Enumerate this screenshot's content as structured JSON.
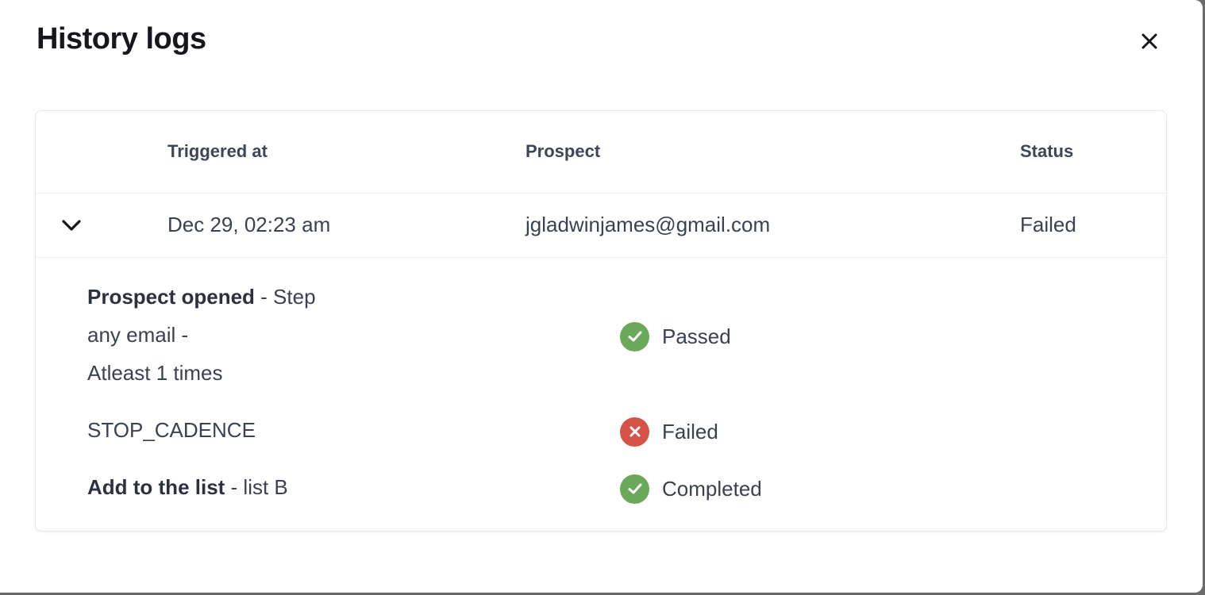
{
  "modal": {
    "title": "History logs",
    "close_icon": "close-icon"
  },
  "table": {
    "columns": {
      "triggered_at": "Triggered at",
      "prospect": "Prospect",
      "status": "Status"
    },
    "rows": [
      {
        "triggered_at": "Dec 29, 02:23 am",
        "prospect": "jgladwinjames@gmail.com",
        "status": "Failed",
        "expanded": true,
        "toggle_icon": "chevron-down-icon",
        "details": [
          {
            "bold": "Prospect opened",
            "rest_line1": " - Step",
            "line2": "any email -",
            "line3": "Atleast 1 times",
            "status": "Passed",
            "status_icon": "check-circle-icon",
            "status_color": "#6aa85a"
          },
          {
            "text": "STOP_CADENCE",
            "status": "Failed",
            "status_icon": "x-circle-icon",
            "status_color": "#d35446"
          },
          {
            "bold": "Add to the list",
            "rest_line1": " - list B",
            "status": "Completed",
            "status_icon": "check-circle-icon",
            "status_color": "#6aa85a"
          }
        ]
      }
    ]
  }
}
